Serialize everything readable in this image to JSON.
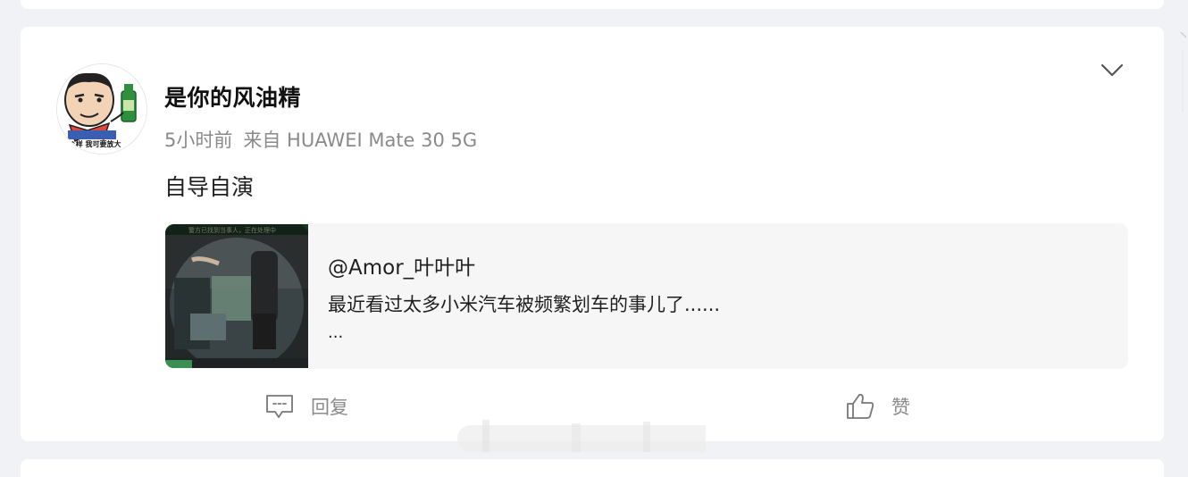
{
  "post": {
    "author": "是你的风油精",
    "time": "5小时前",
    "source": "来自 HUAWEI Mate 30 5G",
    "text": "自导自演",
    "avatar_caption": "^样 我可要放大",
    "more_icon": "chevron-down-icon"
  },
  "repost": {
    "user": "@Amor_叶叶叶",
    "text": "最近看过太多小米汽车被频繁划车的事儿了......",
    "more": "...",
    "thumb_caption": "警方已找到当事人，正在处理中"
  },
  "actions": {
    "reply_label": "回复",
    "reply_icon": "comment-icon",
    "like_label": "赞",
    "like_icon": "thumbs-up-icon"
  },
  "colors": {
    "page_bg": "#f1f2f5",
    "card_bg": "#ffffff",
    "meta_text": "#8a8a8a",
    "repost_bg": "#f6f6f7"
  }
}
